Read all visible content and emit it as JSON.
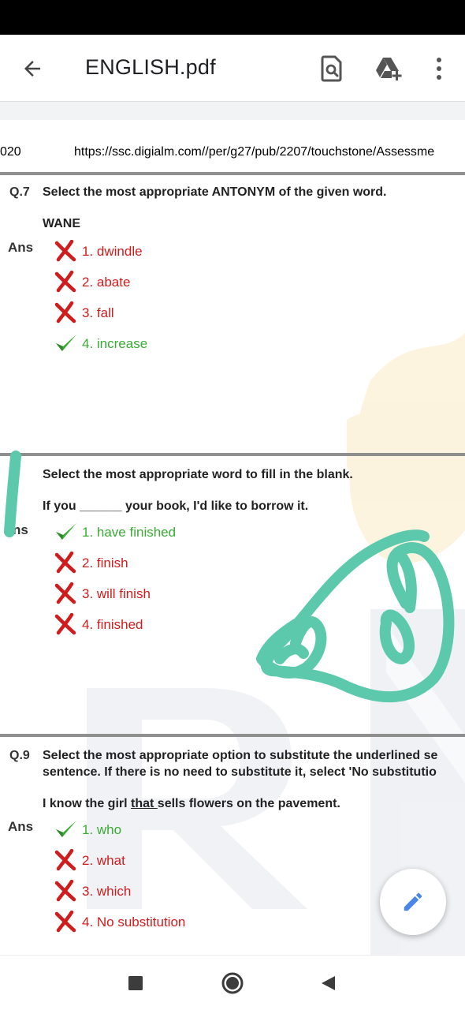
{
  "app_bar": {
    "title": "ENGLISH.pdf",
    "back_icon": "arrow-back-icon",
    "find_icon": "find-in-page-icon",
    "drive_icon": "add-to-drive-icon",
    "more_icon": "more-vert-icon"
  },
  "document": {
    "header_left": "020",
    "header_url": "https://ssc.digialm.com//per/g27/pub/2207/touchstone/Assessme",
    "questions": [
      {
        "number": "Q.7",
        "text": "Select the most appropriate ANTONYM of the given word.",
        "prompt": "WANE",
        "ans_label": "Ans",
        "options": [
          {
            "label": "1. dwindle",
            "correct": false
          },
          {
            "label": "2. abate",
            "correct": false
          },
          {
            "label": "3. fall",
            "correct": false
          },
          {
            "label": "4. increase",
            "correct": true
          }
        ]
      },
      {
        "number": "",
        "text": "Select the most appropriate word to fill in the blank.",
        "prompt": "If you ______ your book, I'd like to borrow it.",
        "ans_label": "ns",
        "options": [
          {
            "label": "1. have finished",
            "correct": true
          },
          {
            "label": "2. finish",
            "correct": false
          },
          {
            "label": "3. will finish",
            "correct": false
          },
          {
            "label": "4. finished",
            "correct": false
          }
        ]
      },
      {
        "number": "Q.9",
        "text_line1": "Select the most appropriate option to substitute the underlined se",
        "text_line2": "sentence. If there is no need to substitute it, select 'No substitutio",
        "prompt_before": "I know the girl ",
        "prompt_underlined": "that ",
        "prompt_after": "sells flowers on the pavement.",
        "ans_label": "Ans",
        "options": [
          {
            "label": "1. who",
            "correct": true
          },
          {
            "label": "2. what",
            "correct": false
          },
          {
            "label": "3. which",
            "correct": false
          },
          {
            "label": "4. No substitution",
            "correct": false
          }
        ]
      }
    ]
  },
  "fab": {
    "icon": "edit-pencil-icon"
  },
  "nav_bar": {
    "recents_icon": "recents-square-icon",
    "home_icon": "home-circle-icon",
    "back_icon": "back-triangle-icon"
  },
  "colors": {
    "wrong": "#d01c1c",
    "correct": "#3aab34",
    "annotation": "#5cc9ad",
    "fab_icon": "#4a86e8"
  }
}
